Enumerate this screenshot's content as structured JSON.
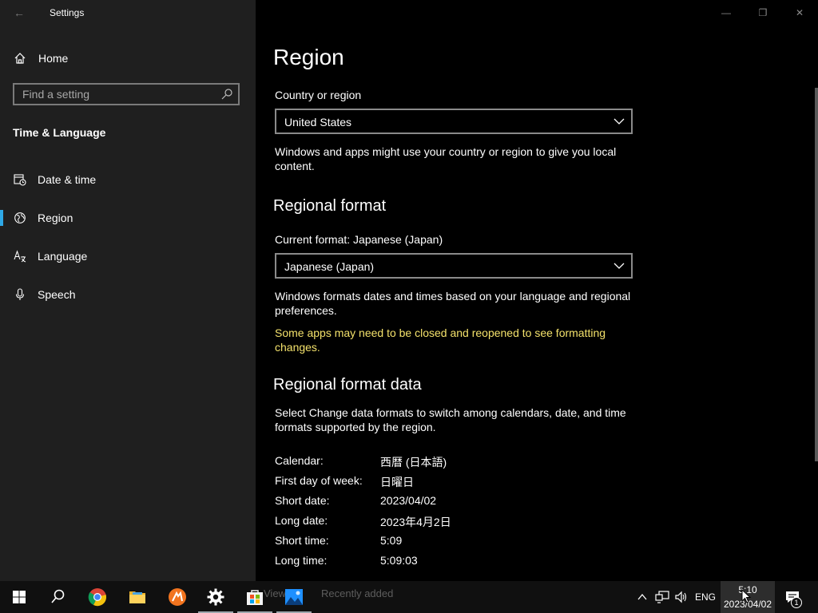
{
  "window": {
    "title": "Settings",
    "back_glyph": "←",
    "min_glyph": "—",
    "restore_glyph": "❐",
    "close_glyph": "✕"
  },
  "sidebar": {
    "home_label": "Home",
    "search_placeholder": "Find a setting",
    "section_title": "Time & Language",
    "items": [
      {
        "label": "Date & time",
        "icon": "calendar-clock-icon"
      },
      {
        "label": "Region",
        "icon": "globe-icon",
        "active": true
      },
      {
        "label": "Language",
        "icon": "language-icon"
      },
      {
        "label": "Speech",
        "icon": "microphone-icon"
      }
    ]
  },
  "content": {
    "title": "Region",
    "country_label": "Country or region",
    "country_value": "United States",
    "country_desc": "Windows and apps might use your country or region to give you local content.",
    "format_heading": "Regional format",
    "current_format_label": "Current format: Japanese (Japan)",
    "format_value": "Japanese (Japan)",
    "format_desc": "Windows formats dates and times based on your language and regional preferences.",
    "format_warning": "Some apps may need to be closed and reopened to see formatting changes.",
    "data_heading": "Regional format data",
    "data_desc": "Select Change data formats to switch among calendars, date, and time formats supported by the region.",
    "rows": [
      {
        "key": "Calendar:",
        "value": "西暦 (日本語)"
      },
      {
        "key": "First day of week:",
        "value": "日曜日"
      },
      {
        "key": "Short date:",
        "value": "2023/04/02"
      },
      {
        "key": "Long date:",
        "value": "2023年4月2日"
      },
      {
        "key": "Short time:",
        "value": "5:09"
      },
      {
        "key": "Long time:",
        "value": "5:09:03"
      }
    ],
    "warning_color": "#f3e16b",
    "accent_color": "#2ea8e6"
  },
  "taskbar": {
    "ghost_left": "View",
    "ghost_right": "Recently added",
    "lang": "ENG",
    "time": "5:10",
    "date": "2023/04/02",
    "notif_count": "1"
  }
}
